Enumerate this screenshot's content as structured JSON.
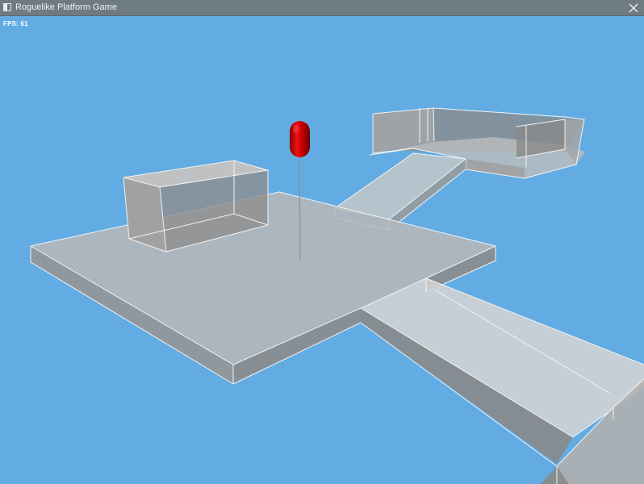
{
  "window": {
    "title": "Roguelike Platform Game",
    "app_icon": "window-app-icon",
    "close_icon": "close-icon"
  },
  "hud": {
    "fps_text": "FPS: 61"
  },
  "scene": {
    "sky_color": "#62ace3",
    "player_color": "#d10000",
    "platform_top_color": "#b6b6b6",
    "platform_side_color": "#8f8f8f",
    "edge_color": "#f2f2f2"
  }
}
